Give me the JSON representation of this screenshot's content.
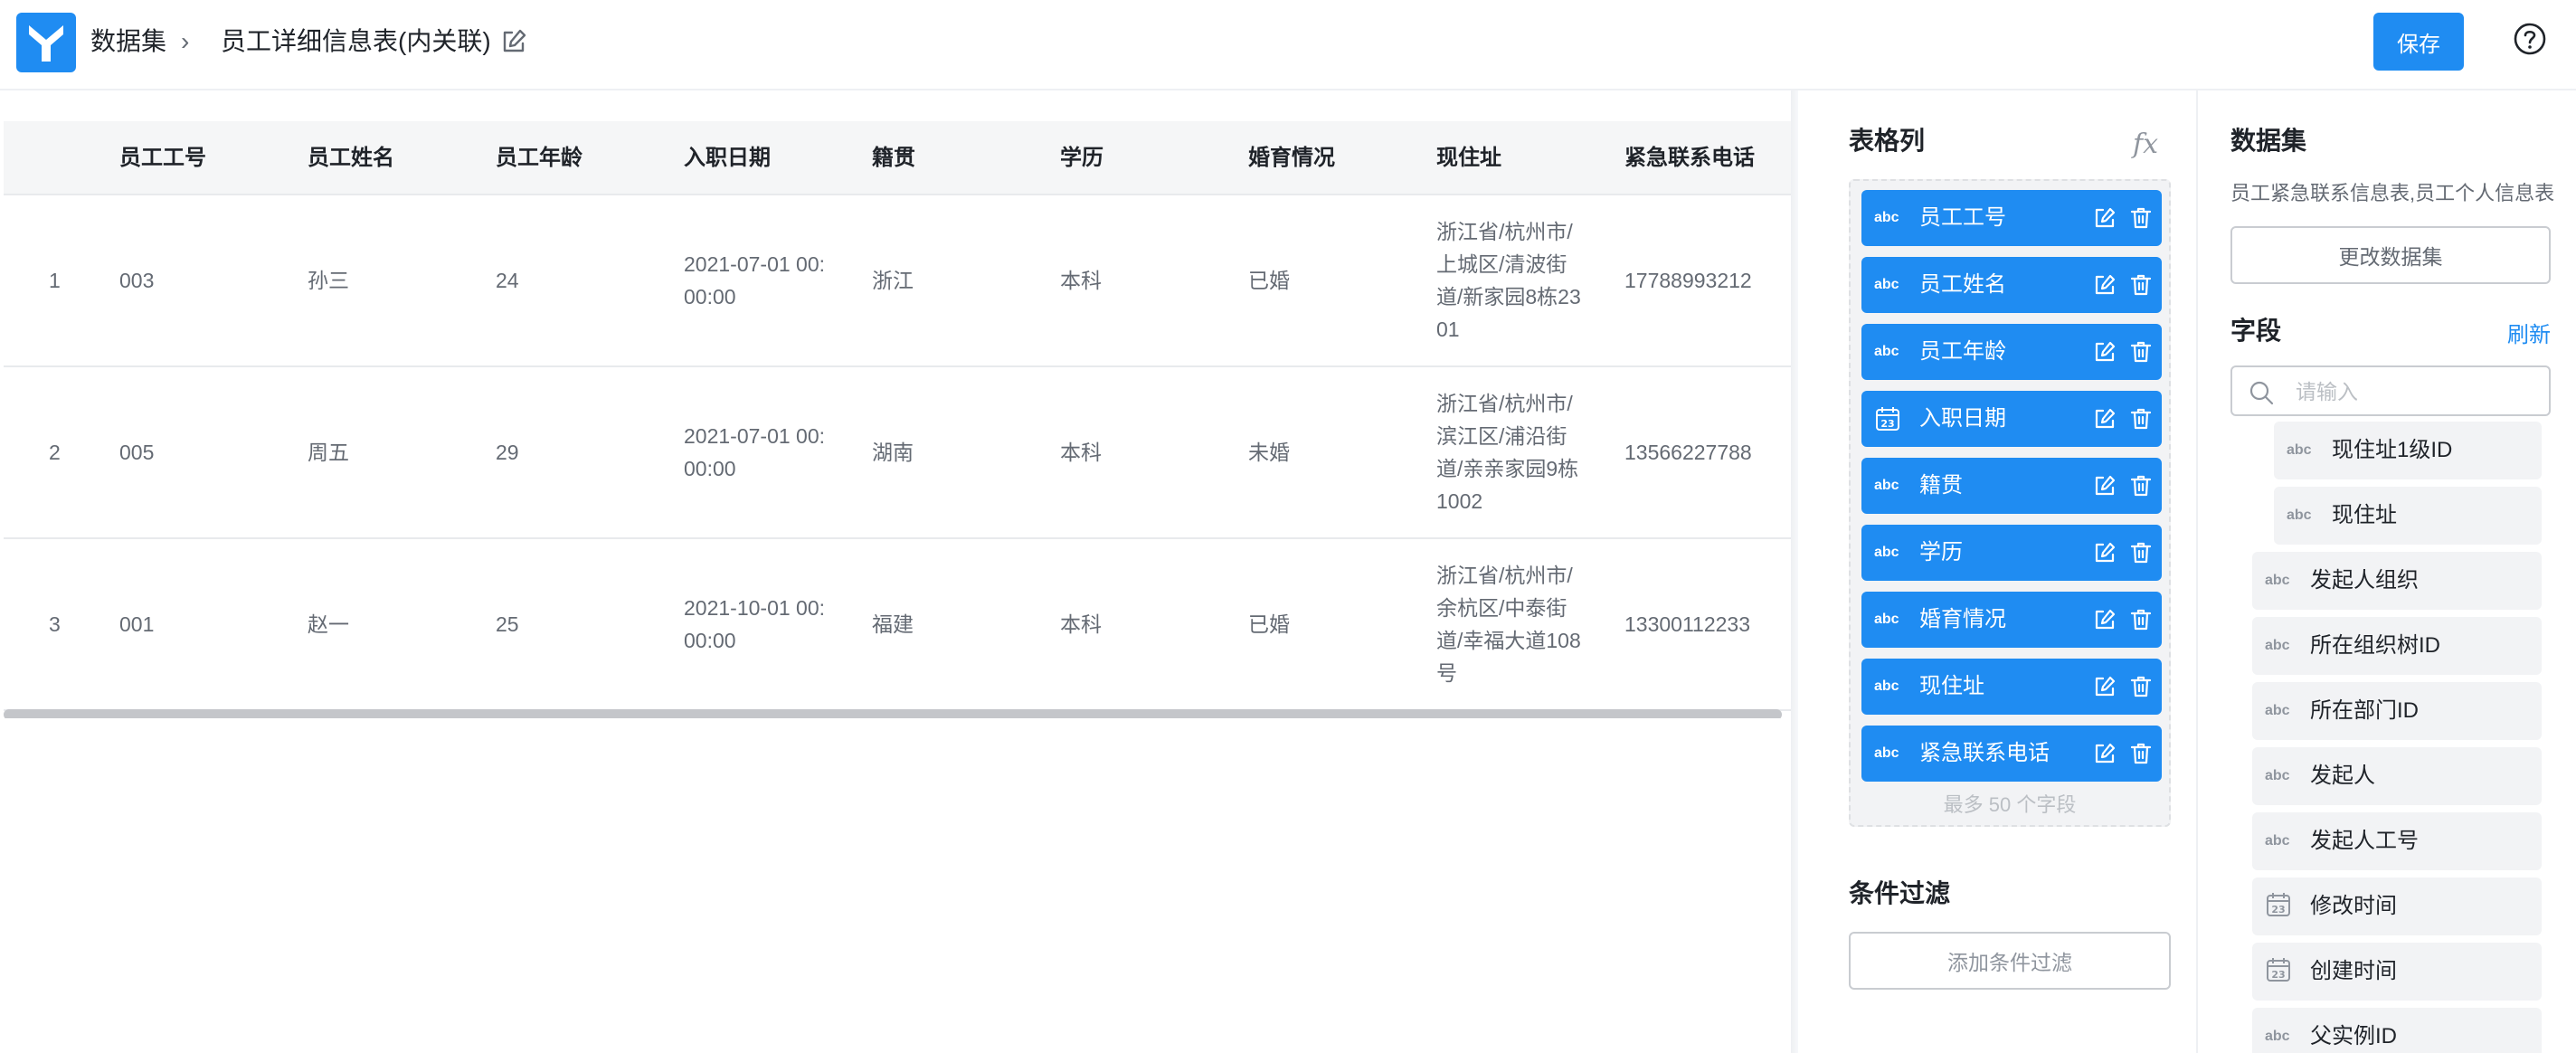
{
  "header": {
    "breadcrumb_root": "数据集",
    "breadcrumb_sep": "›",
    "title": "员工详细信息表(内关联)",
    "save_label": "保存"
  },
  "table": {
    "columns": [
      "员工工号",
      "员工姓名",
      "员工年龄",
      "入职日期",
      "籍贯",
      "学历",
      "婚育情况",
      "现住址",
      "紧急联系电话"
    ],
    "rows": [
      {
        "index": "1",
        "id": "003",
        "name": "孙三",
        "age": "24",
        "date_line1": "2021-07-01 00:",
        "date_line2": "00:00",
        "origin": "浙江",
        "edu": "本科",
        "marital": "已婚",
        "addr": [
          "浙江省/杭州市/",
          "上城区/清波街",
          "道/新家园8栋23",
          "01"
        ],
        "phone": "17788993212"
      },
      {
        "index": "2",
        "id": "005",
        "name": "周五",
        "age": "29",
        "date_line1": "2021-07-01 00:",
        "date_line2": "00:00",
        "origin": "湖南",
        "edu": "本科",
        "marital": "未婚",
        "addr": [
          "浙江省/杭州市/",
          "滨江区/浦沿街",
          "道/亲亲家园9栋",
          "1002"
        ],
        "phone": "13566227788"
      },
      {
        "index": "3",
        "id": "001",
        "name": "赵一",
        "age": "25",
        "date_line1": "2021-10-01 00:",
        "date_line2": "00:00",
        "origin": "福建",
        "edu": "本科",
        "marital": "已婚",
        "addr": [
          "浙江省/杭州市/",
          "余杭区/中泰街",
          "道/幸福大道108",
          "号"
        ],
        "phone": "13300112233"
      }
    ]
  },
  "columns_panel": {
    "title": "表格列",
    "fx_label": "fx",
    "items": [
      {
        "type": "abc",
        "label": "员工工号"
      },
      {
        "type": "date",
        "label": "员工姓名"
      },
      {
        "type": "abc",
        "label": "员工年龄"
      },
      {
        "type": "date",
        "label": "入职日期"
      },
      {
        "type": "abc",
        "label": "籍贯"
      },
      {
        "type": "abc",
        "label": "学历"
      },
      {
        "type": "abc",
        "label": "婚育情况"
      },
      {
        "type": "abc",
        "label": "现住址"
      },
      {
        "type": "abc",
        "label": "紧急联系电话"
      }
    ],
    "type_abc": "abc",
    "max_hint": "最多 50 个字段"
  },
  "filter_panel": {
    "title": "条件过滤",
    "add_label": "添加条件过滤"
  },
  "dataset_panel": {
    "title": "数据集",
    "description": "员工紧急联系信息表,员工个人信息表",
    "change_label": "更改数据集",
    "fields_title": "字段",
    "refresh_label": "刷新",
    "search_placeholder": "请输入",
    "fields": [
      {
        "type": "abc",
        "label": "现住址1级ID",
        "indent": true
      },
      {
        "type": "abc",
        "label": "现住址",
        "indent": true
      },
      {
        "type": "abc",
        "label": "发起人组织",
        "indent": false
      },
      {
        "type": "abc",
        "label": "所在组织树ID",
        "indent": false
      },
      {
        "type": "abc",
        "label": "所在部门ID",
        "indent": false
      },
      {
        "type": "abc",
        "label": "发起人",
        "indent": false
      },
      {
        "type": "abc",
        "label": "发起人工号",
        "indent": false
      },
      {
        "type": "date",
        "label": "修改时间",
        "indent": false
      },
      {
        "type": "date",
        "label": "创建时间",
        "indent": false
      },
      {
        "type": "abc",
        "label": "父实例ID",
        "indent": false
      }
    ]
  },
  "colors": {
    "accent": "#1f8cf2",
    "header_bg": "#f5f6f7",
    "field_bg": "#f2f3f5"
  }
}
